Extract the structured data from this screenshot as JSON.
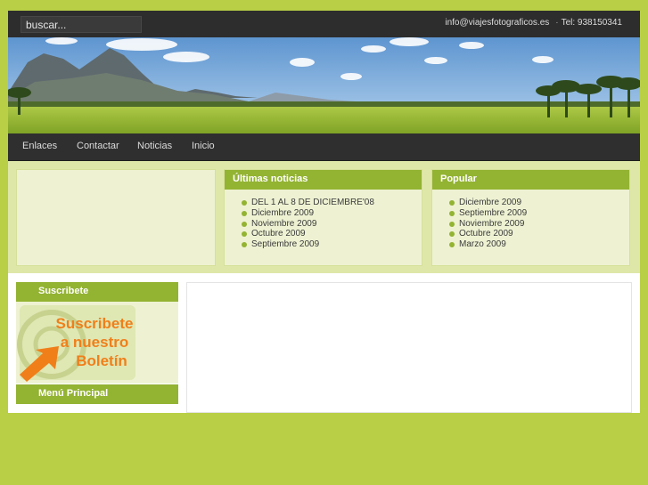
{
  "search": {
    "placeholder": "buscar..."
  },
  "contact": {
    "email": "info@viajesfotograficos.es",
    "phone": "Tel: 938150341"
  },
  "nav": {
    "items": [
      "Enlaces",
      "Contactar",
      "Noticias",
      "Inicio"
    ]
  },
  "news": {
    "title": "Últimas noticias",
    "items": [
      "DEL 1 AL 8 DE DICIEMBRE'08",
      "Diciembre 2009",
      "Noviembre 2009",
      "Octubre 2009",
      "Septiembre 2009"
    ]
  },
  "popular": {
    "title": "Popular",
    "items": [
      "Diciembre 2009",
      "Septiembre 2009",
      "Noviembre 2009",
      "Octubre 2009",
      "Marzo 2009"
    ]
  },
  "sidebar": {
    "subscribe_title": "Suscribete",
    "promo": {
      "line1": "Suscribete",
      "line2": "a nuestro",
      "line3": "Boletín"
    },
    "menu_title": "Menú Principal"
  },
  "colors": {
    "accent": "#93b332",
    "background": "#b9cf45",
    "dark": "#2d2d2d"
  }
}
